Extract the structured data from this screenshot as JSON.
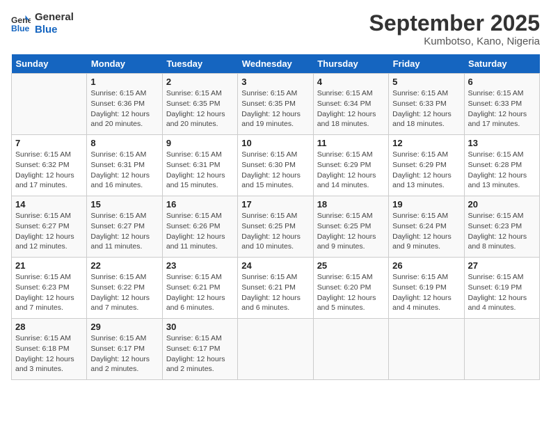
{
  "header": {
    "logo_line1": "General",
    "logo_line2": "Blue",
    "month": "September 2025",
    "location": "Kumbotso, Kano, Nigeria"
  },
  "weekdays": [
    "Sunday",
    "Monday",
    "Tuesday",
    "Wednesday",
    "Thursday",
    "Friday",
    "Saturday"
  ],
  "weeks": [
    [
      {
        "day": "",
        "info": ""
      },
      {
        "day": "1",
        "info": "Sunrise: 6:15 AM\nSunset: 6:36 PM\nDaylight: 12 hours\nand 20 minutes."
      },
      {
        "day": "2",
        "info": "Sunrise: 6:15 AM\nSunset: 6:35 PM\nDaylight: 12 hours\nand 20 minutes."
      },
      {
        "day": "3",
        "info": "Sunrise: 6:15 AM\nSunset: 6:35 PM\nDaylight: 12 hours\nand 19 minutes."
      },
      {
        "day": "4",
        "info": "Sunrise: 6:15 AM\nSunset: 6:34 PM\nDaylight: 12 hours\nand 18 minutes."
      },
      {
        "day": "5",
        "info": "Sunrise: 6:15 AM\nSunset: 6:33 PM\nDaylight: 12 hours\nand 18 minutes."
      },
      {
        "day": "6",
        "info": "Sunrise: 6:15 AM\nSunset: 6:33 PM\nDaylight: 12 hours\nand 17 minutes."
      }
    ],
    [
      {
        "day": "7",
        "info": "Sunrise: 6:15 AM\nSunset: 6:32 PM\nDaylight: 12 hours\nand 17 minutes."
      },
      {
        "day": "8",
        "info": "Sunrise: 6:15 AM\nSunset: 6:31 PM\nDaylight: 12 hours\nand 16 minutes."
      },
      {
        "day": "9",
        "info": "Sunrise: 6:15 AM\nSunset: 6:31 PM\nDaylight: 12 hours\nand 15 minutes."
      },
      {
        "day": "10",
        "info": "Sunrise: 6:15 AM\nSunset: 6:30 PM\nDaylight: 12 hours\nand 15 minutes."
      },
      {
        "day": "11",
        "info": "Sunrise: 6:15 AM\nSunset: 6:29 PM\nDaylight: 12 hours\nand 14 minutes."
      },
      {
        "day": "12",
        "info": "Sunrise: 6:15 AM\nSunset: 6:29 PM\nDaylight: 12 hours\nand 13 minutes."
      },
      {
        "day": "13",
        "info": "Sunrise: 6:15 AM\nSunset: 6:28 PM\nDaylight: 12 hours\nand 13 minutes."
      }
    ],
    [
      {
        "day": "14",
        "info": "Sunrise: 6:15 AM\nSunset: 6:27 PM\nDaylight: 12 hours\nand 12 minutes."
      },
      {
        "day": "15",
        "info": "Sunrise: 6:15 AM\nSunset: 6:27 PM\nDaylight: 12 hours\nand 11 minutes."
      },
      {
        "day": "16",
        "info": "Sunrise: 6:15 AM\nSunset: 6:26 PM\nDaylight: 12 hours\nand 11 minutes."
      },
      {
        "day": "17",
        "info": "Sunrise: 6:15 AM\nSunset: 6:25 PM\nDaylight: 12 hours\nand 10 minutes."
      },
      {
        "day": "18",
        "info": "Sunrise: 6:15 AM\nSunset: 6:25 PM\nDaylight: 12 hours\nand 9 minutes."
      },
      {
        "day": "19",
        "info": "Sunrise: 6:15 AM\nSunset: 6:24 PM\nDaylight: 12 hours\nand 9 minutes."
      },
      {
        "day": "20",
        "info": "Sunrise: 6:15 AM\nSunset: 6:23 PM\nDaylight: 12 hours\nand 8 minutes."
      }
    ],
    [
      {
        "day": "21",
        "info": "Sunrise: 6:15 AM\nSunset: 6:23 PM\nDaylight: 12 hours\nand 7 minutes."
      },
      {
        "day": "22",
        "info": "Sunrise: 6:15 AM\nSunset: 6:22 PM\nDaylight: 12 hours\nand 7 minutes."
      },
      {
        "day": "23",
        "info": "Sunrise: 6:15 AM\nSunset: 6:21 PM\nDaylight: 12 hours\nand 6 minutes."
      },
      {
        "day": "24",
        "info": "Sunrise: 6:15 AM\nSunset: 6:21 PM\nDaylight: 12 hours\nand 6 minutes."
      },
      {
        "day": "25",
        "info": "Sunrise: 6:15 AM\nSunset: 6:20 PM\nDaylight: 12 hours\nand 5 minutes."
      },
      {
        "day": "26",
        "info": "Sunrise: 6:15 AM\nSunset: 6:19 PM\nDaylight: 12 hours\nand 4 minutes."
      },
      {
        "day": "27",
        "info": "Sunrise: 6:15 AM\nSunset: 6:19 PM\nDaylight: 12 hours\nand 4 minutes."
      }
    ],
    [
      {
        "day": "28",
        "info": "Sunrise: 6:15 AM\nSunset: 6:18 PM\nDaylight: 12 hours\nand 3 minutes."
      },
      {
        "day": "29",
        "info": "Sunrise: 6:15 AM\nSunset: 6:17 PM\nDaylight: 12 hours\nand 2 minutes."
      },
      {
        "day": "30",
        "info": "Sunrise: 6:15 AM\nSunset: 6:17 PM\nDaylight: 12 hours\nand 2 minutes."
      },
      {
        "day": "",
        "info": ""
      },
      {
        "day": "",
        "info": ""
      },
      {
        "day": "",
        "info": ""
      },
      {
        "day": "",
        "info": ""
      }
    ]
  ]
}
